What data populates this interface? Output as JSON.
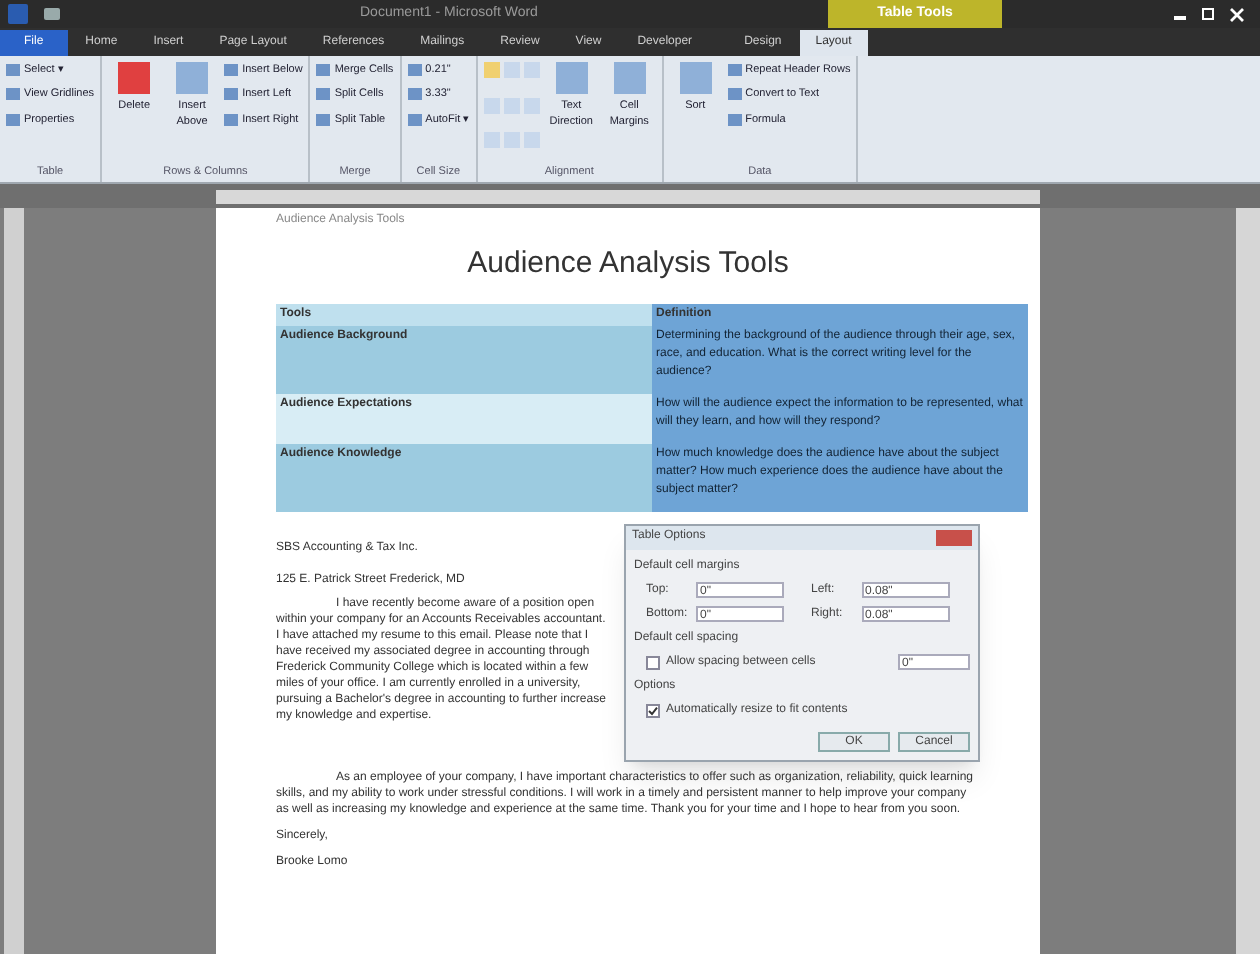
{
  "window": {
    "title": "Document1 - Microsoft Word",
    "context_tab": "Table Tools"
  },
  "tabs": [
    {
      "label": "File",
      "selected": false,
      "kind": "file"
    },
    {
      "label": "Home",
      "selected": false,
      "kind": "tab"
    },
    {
      "label": "Insert",
      "selected": false,
      "kind": "tab"
    },
    {
      "label": "Page Layout",
      "selected": false,
      "kind": "tab"
    },
    {
      "label": "References",
      "selected": false,
      "kind": "tab"
    },
    {
      "label": "Mailings",
      "selected": false,
      "kind": "tab"
    },
    {
      "label": "Review",
      "selected": false,
      "kind": "tab"
    },
    {
      "label": "View",
      "selected": false,
      "kind": "tab"
    },
    {
      "label": "Developer",
      "selected": false,
      "kind": "tab"
    },
    {
      "label": "Design",
      "selected": false,
      "kind": "tab"
    },
    {
      "label": "Layout",
      "selected": true,
      "kind": "tab"
    }
  ],
  "ribbon": [
    {
      "name": "Table",
      "small": [
        "Select ▾",
        "View Gridlines",
        "Properties"
      ]
    },
    {
      "name": "Rows & Columns",
      "large": [
        "Delete",
        "Insert Above"
      ],
      "small": [
        "Insert Below",
        "Insert Left",
        "Insert Right"
      ]
    },
    {
      "name": "Merge",
      "small": [
        "Merge Cells",
        "Split Cells",
        "Split Table"
      ]
    },
    {
      "name": "Cell Size",
      "small": [
        "0.21\"",
        "3.33\"",
        "AutoFit ▾"
      ]
    },
    {
      "name": "Alignment",
      "large": [
        "Text Direction",
        "Cell Margins"
      ]
    },
    {
      "name": "Data",
      "large": [
        "Sort"
      ],
      "small": [
        "Repeat Header Rows",
        "Convert to Text",
        "Formula"
      ]
    }
  ],
  "document": {
    "header_lines": [
      "Audience Analysis Tools"
    ],
    "title": "Audience Analysis Tools",
    "table": {
      "columns": [
        {
          "label": "Tools",
          "selected": false
        },
        {
          "label": "Definition",
          "selected": true
        }
      ],
      "rows": [
        [
          "Audience Background",
          "Determining the background of the audience through their age, sex, race, and education. What is the correct writing level for the audience?"
        ],
        [
          "Audience Expectations",
          "How will the audience expect the information to be represented, what will they learn, and how will they respond?"
        ],
        [
          "Audience Knowledge",
          "How much knowledge does the audience have about the subject matter? How much experience does the audience have about the subject matter?"
        ]
      ]
    },
    "address": [
      "SBS Accounting & Tax Inc.",
      "125 E. Patrick Street Frederick, MD"
    ],
    "paragraphs": [
      "I have recently become aware of a position open within your company for an Accounts Receivables accountant. I have attached my resume to this email. Please note that I have received my associated degree in accounting through Frederick Community College which is located within a few miles of your office. I am currently enrolled in a university, pursuing a Bachelor's degree in accounting to further increase my knowledge and expertise.",
      "As an employee of your company, I have important characteristics to offer such as organization, reliability, quick learning skills, and my ability to work under stressful conditions. I will work in a timely and persistent manner to help improve your company as well as increasing my knowledge and experience at the same time. Thank you for your time and I hope to hear from you soon."
    ],
    "closing": "Sincerely,",
    "signature": "Brooke Lomo"
  },
  "dialog": {
    "title": "Table Options",
    "margins_label": "Default cell margins",
    "fields": [
      {
        "label": "Top:",
        "value": "0\""
      },
      {
        "label": "Left:",
        "value": "0.08\""
      },
      {
        "label": "Bottom:",
        "value": "0\""
      },
      {
        "label": "Right:",
        "value": "0.08\""
      }
    ],
    "spacing_label": "Default cell spacing",
    "spacing": {
      "label": "Allow spacing between cells",
      "checked": false,
      "value": "0\""
    },
    "options_label": "Options",
    "autoresize": {
      "label": "Automatically resize to fit contents",
      "checked": true
    },
    "buttons": [
      "OK",
      "Cancel"
    ]
  }
}
